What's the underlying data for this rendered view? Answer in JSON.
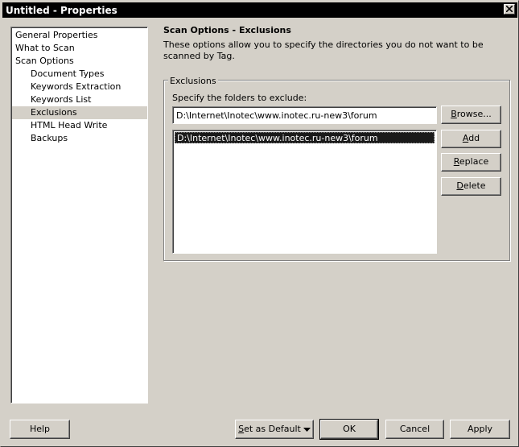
{
  "window": {
    "title": "Untitled - Properties"
  },
  "tree": {
    "items": [
      {
        "label": "General Properties"
      },
      {
        "label": "What to Scan"
      },
      {
        "label": "Scan Options"
      },
      {
        "label": "Document Types"
      },
      {
        "label": "Keywords Extraction"
      },
      {
        "label": "Keywords List"
      },
      {
        "label": "Exclusions"
      },
      {
        "label": "HTML Head Write"
      },
      {
        "label": "Backups"
      }
    ],
    "selected": "Exclusions"
  },
  "panel": {
    "title": "Scan Options - Exclusions",
    "description": "These options allow you to specify the directories you do not want to be scanned by Tag.",
    "group_label": "Exclusions",
    "folder_label": "Specify the folders to exclude:",
    "path_value": "D:\\Internet\\Inotec\\www.inotec.ru-new3\\forum",
    "list_items": [
      "D:\\Internet\\Inotec\\www.inotec.ru-new3\\forum"
    ]
  },
  "side_buttons": {
    "browse": {
      "first": "B",
      "rest": "rowse..."
    },
    "add": {
      "first": "A",
      "rest": "dd"
    },
    "replace": {
      "first": "R",
      "rest": "eplace"
    },
    "delete": {
      "first": "D",
      "rest": "elete"
    }
  },
  "footer": {
    "help": "Help",
    "set_default": {
      "first": "S",
      "rest": "et as Default"
    },
    "ok": "OK",
    "cancel": "Cancel",
    "apply": "Apply"
  }
}
